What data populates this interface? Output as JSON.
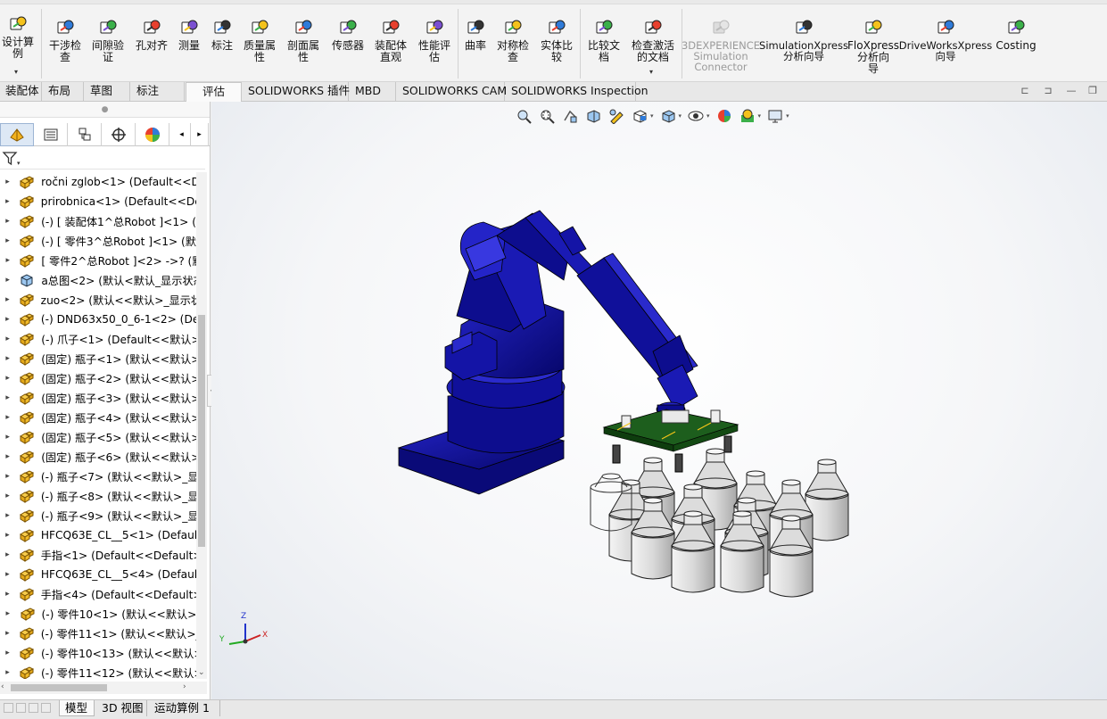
{
  "ribbon": {
    "buttons": [
      {
        "name": "design-study-button",
        "label": "设计算\n例",
        "icon": "design-study-icon"
      },
      {
        "name": "interference-check-button",
        "label": "干涉检\n查",
        "icon": "interference-icon"
      },
      {
        "name": "clearance-verify-button",
        "label": "间隙验\n证",
        "icon": "clearance-icon"
      },
      {
        "name": "hole-align-button",
        "label": "孔对齐",
        "icon": "hole-align-icon"
      },
      {
        "name": "measure-button",
        "label": "测量",
        "icon": "measure-icon"
      },
      {
        "name": "markup-button",
        "label": "标注",
        "icon": "markup-icon"
      },
      {
        "name": "mass-properties-button",
        "label": "质量属\n性",
        "icon": "mass-icon"
      },
      {
        "name": "section-properties-button",
        "label": "剖面属\n性",
        "icon": "section-icon"
      },
      {
        "name": "sensor-button",
        "label": "传感器",
        "icon": "sensor-icon"
      },
      {
        "name": "assembly-visualization-button",
        "label": "装配体\n直观",
        "icon": "assembly-vis-icon"
      },
      {
        "name": "performance-evaluation-button",
        "label": "性能评\n估",
        "icon": "performance-icon"
      },
      {
        "name": "curvature-button",
        "label": "曲率",
        "icon": "curvature-icon"
      },
      {
        "name": "symmetry-check-button",
        "label": "对称检\n查",
        "icon": "symmetry-icon"
      },
      {
        "name": "compare-geometry-button",
        "label": "实体比\n较",
        "icon": "compare-geometry-icon"
      },
      {
        "name": "compare-documents-button",
        "label": "比较文\n档",
        "icon": "compare-doc-icon"
      },
      {
        "name": "check-active-document-button",
        "label": "检查激活\n的文档",
        "icon": "check-doc-icon"
      },
      {
        "name": "3dexperience-simulation-button",
        "label": "3DEXPERIENCE\nSimulation\nConnector",
        "icon": "3dx-icon"
      },
      {
        "name": "simulationxpress-button",
        "label": "SimulationXpress\n分析向导",
        "icon": "simxpress-icon"
      },
      {
        "name": "floxpress-button",
        "label": "FloXpress\n分析向\n导",
        "icon": "floxpress-icon"
      },
      {
        "name": "driveworksxpress-button",
        "label": "DriveWorksXpress\n向导",
        "icon": "driveworks-icon"
      },
      {
        "name": "costing-button",
        "label": "Costing",
        "icon": "costing-icon"
      }
    ]
  },
  "tabs": [
    {
      "label": "装配体"
    },
    {
      "label": "布局"
    },
    {
      "label": "草图"
    },
    {
      "label": "标注"
    },
    {
      "label": "评估",
      "active": true
    },
    {
      "label": "SOLIDWORKS 插件"
    },
    {
      "label": "MBD"
    },
    {
      "label": "SOLIDWORKS CAM"
    },
    {
      "label": "SOLIDWORKS Inspection"
    }
  ],
  "tree": {
    "items": [
      "ročni zglob<1> (Default<<De",
      "prirobnica<1> (Default<<Defa",
      "(-) [ 装配体1^总Robot ]<1> (默",
      "(-) [ 零件3^总Robot ]<1> (默认",
      "[ 零件2^总Robot ]<2> ->? (默",
      "a总图<2> (默认<默认_显示状态",
      "zuo<2> (默认<<默认>_显示状态",
      "(-) DND63x50_0_6-1<2> (Defa",
      "(-) 爪子<1> (Default<<默认>_",
      "(固定) 瓶子<1> (默认<<默认>_",
      "(固定) 瓶子<2> (默认<<默认>_",
      "(固定) 瓶子<3> (默认<<默认>_",
      "(固定) 瓶子<4> (默认<<默认>_",
      "(固定) 瓶子<5> (默认<<默认>_",
      "(固定) 瓶子<6> (默认<<默认>_",
      "(-) 瓶子<7> (默认<<默认>_显示",
      "(-) 瓶子<8> (默认<<默认>_显示",
      "(-) 瓶子<9> (默认<<默认>_显示",
      "HFCQ63E_CL__5<1> (Default<",
      "手指<1> (Default<<Default>_!",
      "HFCQ63E_CL__5<4> (Default<",
      "手指<4> (Default<<Default>_!",
      "(-) 零件10<1> (默认<<默认>_",
      "(-) 零件11<1> (默认<<默认>_显",
      "(-) 零件10<13> (默认<<默认>_",
      "(-) 零件11<12> (默认<<默认>_"
    ]
  },
  "bottom_tabs": [
    {
      "label": "模型",
      "active": true
    },
    {
      "label": "3D 视图"
    },
    {
      "label": "运动算例 1"
    }
  ],
  "triad": {
    "x": "X",
    "y": "Y",
    "z": "Z"
  },
  "colors": {
    "robot": "#0d0d8e",
    "bottle": "#d6d6d6",
    "pcb": "#1d5e1d",
    "accent": "#f5c518"
  }
}
